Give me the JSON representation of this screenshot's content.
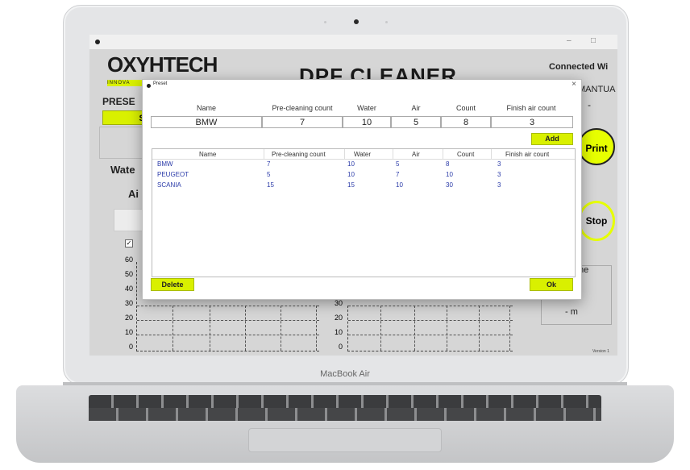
{
  "device_label": "MacBook Air",
  "app": {
    "logo": "OXYHTECH",
    "logo_tag": "INNOVA",
    "title": "DPF CLEANER",
    "connected": "Connected Wi",
    "manual": "MANTUA",
    "dash": "-",
    "preset_label": "PRESE",
    "select_btn": "Se",
    "water_label": "Wate",
    "air_label": "Ai",
    "checkbox": "✓",
    "print_btn": "Print",
    "stop_btn": "Stop",
    "time_label": "me",
    "time_value": "- m",
    "version": "Version 1",
    "minimize": "–",
    "maximize": "□",
    "chart_ticks": [
      "60",
      "50",
      "40",
      "30",
      "20",
      "10",
      "0"
    ],
    "chart2_ticks": [
      "30",
      "20",
      "10",
      "0"
    ]
  },
  "dialog": {
    "title": "Preset",
    "close": "×",
    "fields": {
      "headers": [
        "Name",
        "Pre-cleaning count",
        "Water",
        "Air",
        "Count",
        "Finish air count"
      ],
      "values": [
        "BMW",
        "7",
        "10",
        "5",
        "8",
        "3"
      ]
    },
    "add_btn": "Add",
    "delete_btn": "Delete",
    "ok_btn": "Ok",
    "grid": {
      "headers": [
        "Name",
        "Pre-cleaning count",
        "Water",
        "Air",
        "Count",
        "Finish air count"
      ],
      "rows": [
        [
          "BMW",
          "7",
          "10",
          "5",
          "8",
          "3"
        ],
        [
          "PEUGEOT",
          "5",
          "10",
          "7",
          "10",
          "3"
        ],
        [
          "SCANIA",
          "15",
          "15",
          "10",
          "30",
          "3"
        ]
      ]
    }
  }
}
